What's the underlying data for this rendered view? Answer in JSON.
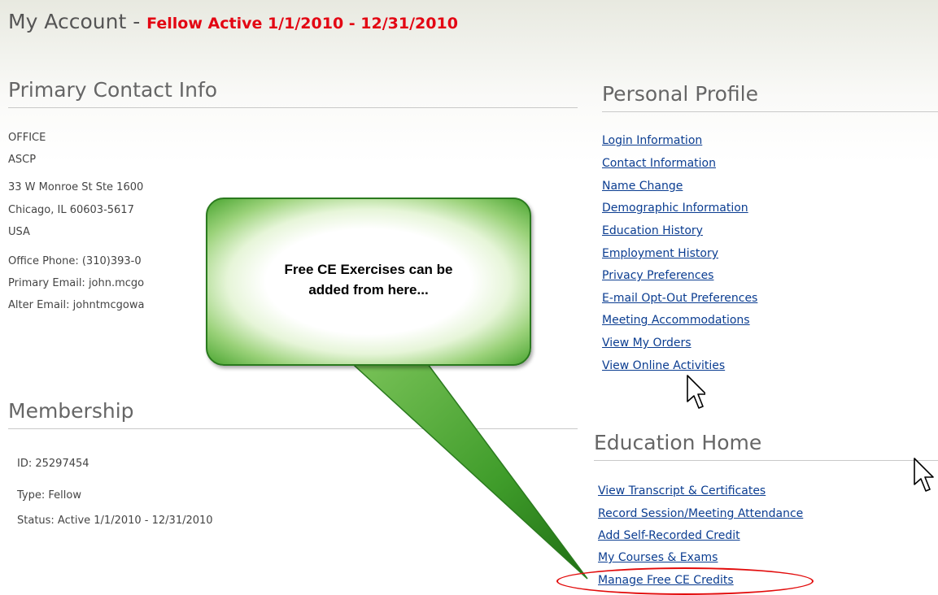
{
  "page": {
    "title_prefix": "My Account - ",
    "title_status": "Fellow Active 1/1/2010 - 12/31/2010"
  },
  "primary_contact": {
    "heading": "Primary Contact Info",
    "type": "OFFICE",
    "organization": "ASCP",
    "street": "33 W Monroe St Ste 1600",
    "city_state_zip": "Chicago, IL 60603-5617",
    "country": "USA",
    "phone": "Office Phone: (310)393-0",
    "primary_email": "Primary Email: john.mcgo",
    "alter_email": "Alter Email: johntmcgowa"
  },
  "membership": {
    "heading": "Membership",
    "id": "ID: 25297454",
    "type": "Type: Fellow",
    "status": "Status:  Active 1/1/2010 - 12/31/2010"
  },
  "personal_profile": {
    "heading": "Personal Profile",
    "links": [
      "Login Information",
      "Contact Information",
      "Name Change",
      "Demographic Information",
      "Education History",
      "Employment History",
      "Privacy Preferences",
      "E-mail Opt-Out Preferences",
      "Meeting Accommodations",
      "View My Orders",
      "View Online Activities"
    ]
  },
  "education_home": {
    "heading": "Education Home",
    "links": [
      "View Transcript & Certificates",
      "Record Session/Meeting Attendance",
      "Add Self-Recorded Credit",
      "My Courses & Exams",
      "Manage Free CE Credits"
    ]
  },
  "callout": {
    "line1": "Free CE Exercises can be",
    "line2": "added from here..."
  },
  "colors": {
    "status_red": "#e30613",
    "link_blue": "#0b3d91",
    "callout_green": "#2a7a1e",
    "highlight_red": "#e20b0b"
  },
  "icons": [
    "arrow-cursor-icon"
  ]
}
